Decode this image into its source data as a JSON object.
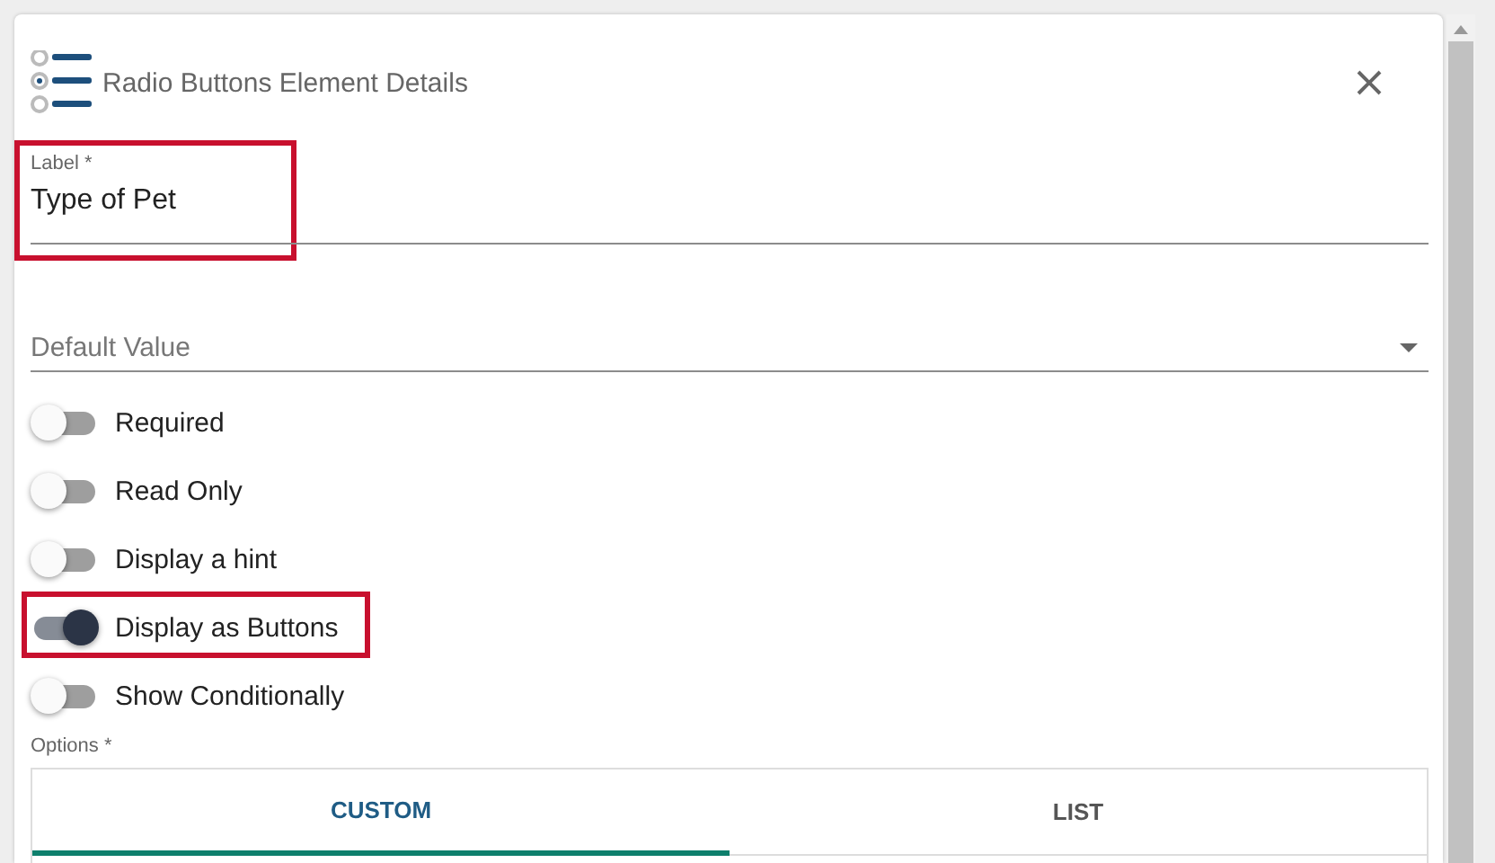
{
  "dialog": {
    "title": "Radio Buttons Element Details"
  },
  "label_field": {
    "label": "Label *",
    "value": "Type of Pet",
    "highlighted": true
  },
  "default_field": {
    "placeholder": "Default Value"
  },
  "toggles": [
    {
      "label": "Required",
      "on": false,
      "highlighted": false
    },
    {
      "label": "Read Only",
      "on": false,
      "highlighted": false
    },
    {
      "label": "Display a hint",
      "on": false,
      "highlighted": false
    },
    {
      "label": "Display as Buttons",
      "on": true,
      "highlighted": true
    },
    {
      "label": "Show Conditionally",
      "on": false,
      "highlighted": false
    }
  ],
  "options": {
    "label": "Options *",
    "tabs": [
      {
        "label": "CUSTOM",
        "selected": true
      },
      {
        "label": "LIST",
        "selected": false
      }
    ]
  }
}
